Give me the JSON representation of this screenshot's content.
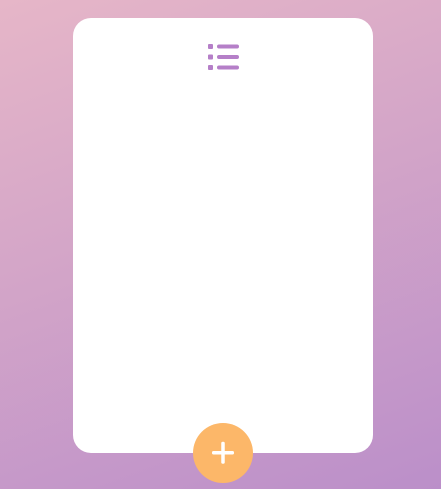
{
  "header": {
    "icon": "list-icon"
  },
  "actions": {
    "add_icon": "plus-icon"
  },
  "colors": {
    "background_start": "#e6b6c8",
    "background_end": "#bb8fc9",
    "card": "#ffffff",
    "accent": "#b57fc8",
    "add_button": "#fcb769",
    "add_button_icon": "#ffffff"
  }
}
